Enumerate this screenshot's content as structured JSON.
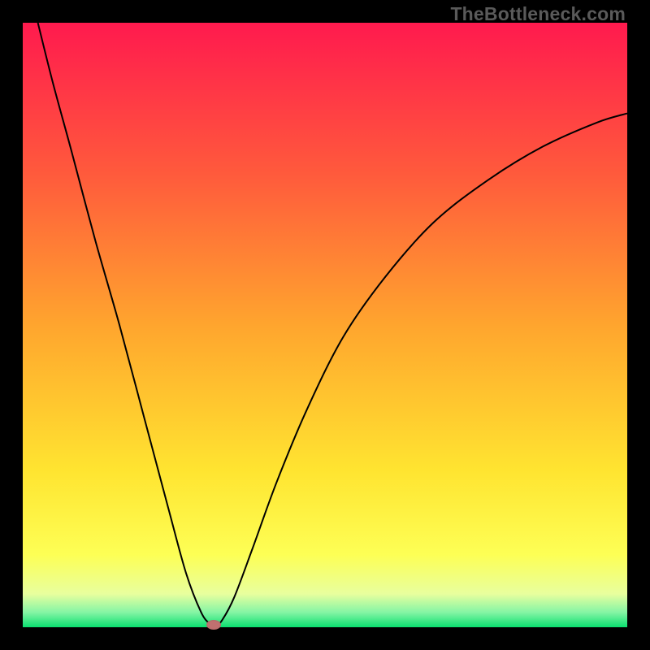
{
  "watermark": "TheBottleneck.com",
  "chart_data": {
    "type": "line",
    "title": "",
    "xlabel": "",
    "ylabel": "",
    "xlim": [
      0,
      100
    ],
    "ylim": [
      0,
      100
    ],
    "gradient_stops": [
      {
        "offset": 0.0,
        "color": "#ff1a4e"
      },
      {
        "offset": 0.25,
        "color": "#ff5a3c"
      },
      {
        "offset": 0.5,
        "color": "#ffa52e"
      },
      {
        "offset": 0.74,
        "color": "#ffe430"
      },
      {
        "offset": 0.88,
        "color": "#fdff55"
      },
      {
        "offset": 0.945,
        "color": "#e8ff9e"
      },
      {
        "offset": 0.975,
        "color": "#86f5a5"
      },
      {
        "offset": 1.0,
        "color": "#0ae070"
      }
    ],
    "series": [
      {
        "name": "bottleneck-curve",
        "x": [
          2.5,
          5,
          8,
          12,
          16,
          20,
          24,
          27,
          29.5,
          31,
          31.8,
          33,
          35,
          38,
          42,
          47,
          53,
          60,
          68,
          77,
          86,
          95,
          100
        ],
        "y": [
          100,
          90,
          79,
          64,
          50,
          35,
          20,
          9,
          2.5,
          0.5,
          0.1,
          1.2,
          5,
          13,
          24,
          36,
          48,
          58,
          67,
          74,
          79.5,
          83.5,
          85
        ]
      }
    ],
    "marker": {
      "x": 31.6,
      "y": 0.4,
      "color": "#c07070"
    }
  }
}
